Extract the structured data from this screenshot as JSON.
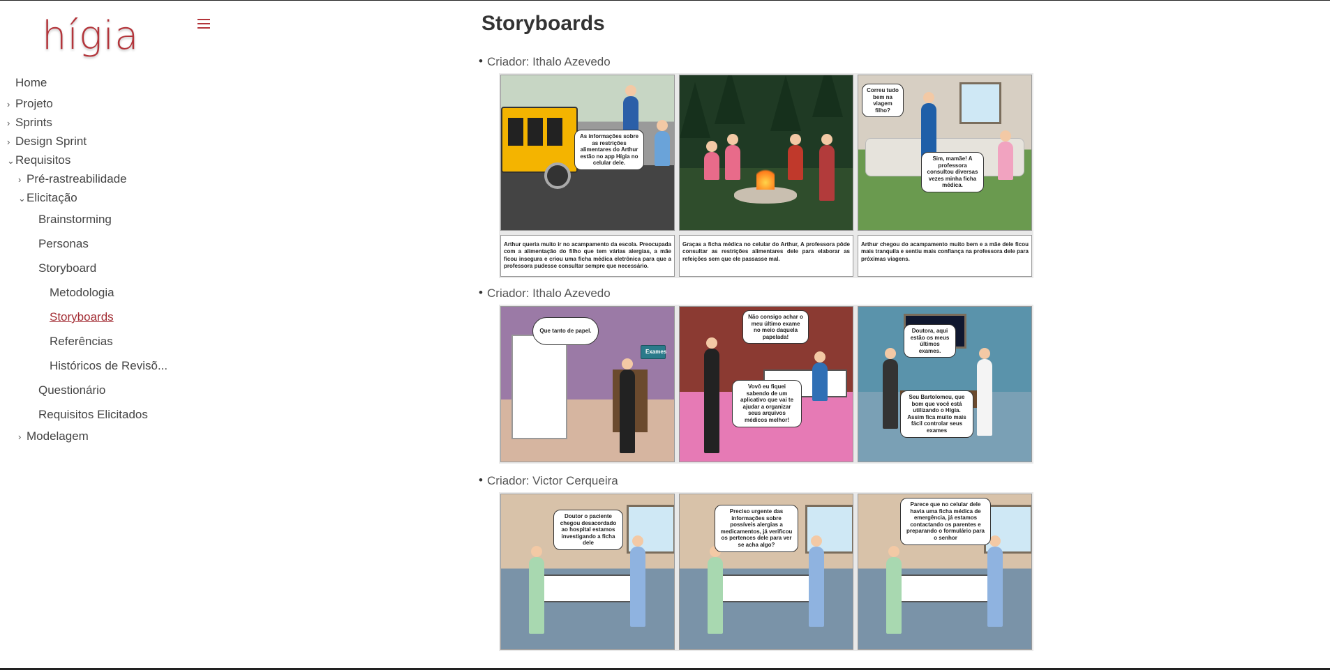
{
  "sidebar": {
    "logo": "hígia",
    "menu_icon": "hamburger-menu-icon",
    "items": [
      {
        "label": "Home",
        "chevron": ""
      },
      {
        "label": "Projeto",
        "chevron": "›"
      },
      {
        "label": "Sprints",
        "chevron": "›"
      },
      {
        "label": "Design Sprint",
        "chevron": "›"
      },
      {
        "label": "Requisitos",
        "chevron": "⌄"
      },
      {
        "label": "Pré-rastreabilidade",
        "chevron": "›"
      },
      {
        "label": "Elicitação",
        "chevron": "⌄"
      },
      {
        "label": "Brainstorming",
        "chevron": ""
      },
      {
        "label": "Personas",
        "chevron": ""
      },
      {
        "label": "Storyboard",
        "chevron": ""
      },
      {
        "label": "Metodologia",
        "chevron": ""
      },
      {
        "label": "Storyboards",
        "chevron": ""
      },
      {
        "label": "Referências",
        "chevron": ""
      },
      {
        "label": "Históricos de Revisõ...",
        "chevron": ""
      },
      {
        "label": "Questionário",
        "chevron": ""
      },
      {
        "label": "Requisitos Elicitados",
        "chevron": ""
      },
      {
        "label": "Modelagem",
        "chevron": "›"
      }
    ],
    "active_item": "Storyboards",
    "accent_color": "#a32d34"
  },
  "main": {
    "title": "Storyboards",
    "sections": [
      {
        "creator": "Criador: Ithalo Azevedo",
        "bubbles": [
          "As informações sobre as restrições alimentares do Arthur estão no app Hígia no celular dele.",
          "",
          "Correu tudo bem na viagem filho?",
          "Sim, mamãe! A professora consultou diversas vezes minha ficha médica."
        ],
        "captions": [
          "Arthur queria muito ir no acampamento da escola. Preocupada com a alimentação do filho que tem várias alergias, a mãe ficou insegura e criou uma ficha médica eletrônica para que a professora pudesse consultar sempre que necessário.",
          "Graças a ficha médica no celular do Arthur, A professora pôde consultar as restrições alimentares dele para elaborar as refeições sem que ele passasse mal.",
          "Arthur chegou do acampamento muito bem e a mãe dele ficou mais tranquila e sentiu mais confiança na professora dele para próximas viagens."
        ]
      },
      {
        "creator": "Criador: Ithalo Azevedo",
        "bubbles": [
          "Que tanto de papel.",
          "Exames",
          "Não consigo achar o meu último exame no meio daquela papelada!",
          "Vovô eu fiquei sabendo de um aplicativo que vai te ajudar a organizar seus arquivos médicos melhor!",
          "Doutora, aqui estão os meus últimos exames.",
          "Seu Bartolomeu, que bom que você está utilizando o Hígia. Assim fica muito mais fácil controlar seus exames"
        ]
      },
      {
        "creator": "Criador: Victor Cerqueira",
        "bubbles": [
          "Doutor o paciente chegou desacordado ao hospital estamos investigando a ficha dele",
          "Preciso urgente das informações sobre possíveis alergias a medicamentos, já verificou os pertences dele para ver se acha algo?",
          "Parece que no celular dele havia uma ficha médica de emergência, já estamos contactando os parentes e preparando o formulário para o senhor"
        ]
      }
    ]
  }
}
